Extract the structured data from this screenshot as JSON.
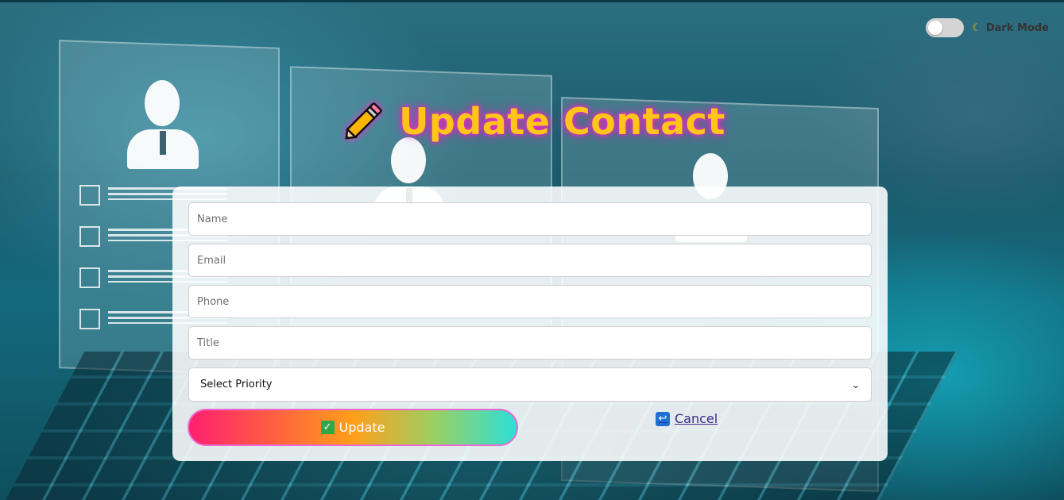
{
  "header": {
    "dark_mode_label": "Dark Mode",
    "dark_mode_on": false,
    "moon_icon": "crescent-moon-icon"
  },
  "page": {
    "title": "Update Contact",
    "title_icon": "pencil-icon",
    "title_color": "#ffc61a",
    "glow_color": "#ff2bd6"
  },
  "form": {
    "name": {
      "placeholder": "Name",
      "value": ""
    },
    "email": {
      "placeholder": "Email",
      "value": ""
    },
    "phone": {
      "placeholder": "Phone",
      "value": ""
    },
    "title": {
      "placeholder": "Title",
      "value": ""
    },
    "priority": {
      "selected": "Select Priority"
    },
    "update_label": "Update",
    "update_icon": "check-mark-icon",
    "cancel_label": "Cancel",
    "cancel_icon": "return-arrow-icon"
  }
}
